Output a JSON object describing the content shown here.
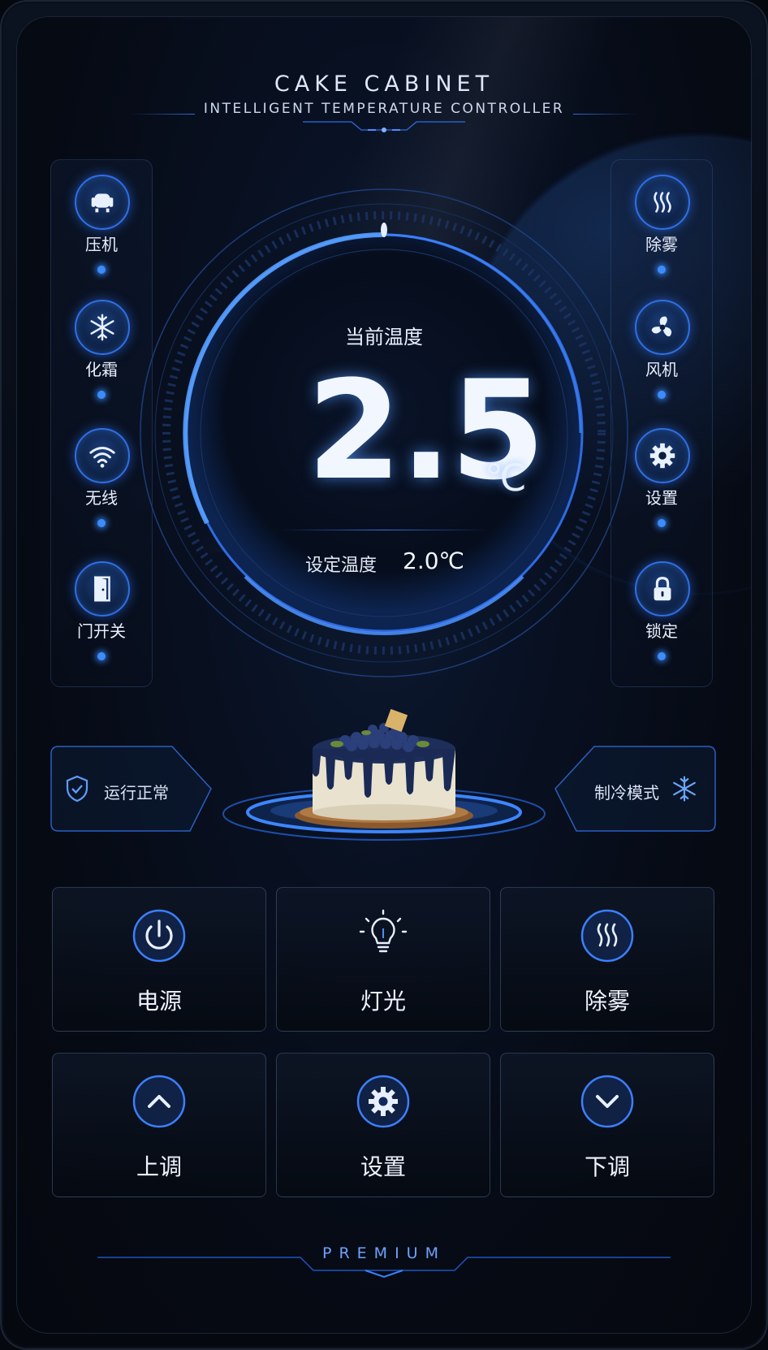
{
  "header": {
    "title": "CAKE CABINET",
    "subtitle": "INTELLIGENT TEMPERATURE CONTROLLER"
  },
  "left_panel": {
    "items": [
      {
        "label": "压机",
        "icon": "compressor-icon"
      },
      {
        "label": "化霜",
        "icon": "snowflake-icon"
      },
      {
        "label": "无线",
        "icon": "wifi-icon"
      },
      {
        "label": "门开关",
        "icon": "door-icon"
      }
    ]
  },
  "right_panel": {
    "items": [
      {
        "label": "除雾",
        "icon": "heat-waves-icon"
      },
      {
        "label": "风机",
        "icon": "fan-icon"
      },
      {
        "label": "设置",
        "icon": "gear-icon"
      },
      {
        "label": "锁定",
        "icon": "lock-icon"
      }
    ]
  },
  "dial": {
    "current_label": "当前温度",
    "current_value": "2.5",
    "unit": "℃",
    "set_label": "设定温度",
    "set_value": "2.0℃"
  },
  "status": {
    "left_text": "运行正常",
    "left_icon": "shield-check-icon",
    "right_text": "制冷模式",
    "right_icon": "snowflake-icon"
  },
  "buttons": [
    {
      "label": "电源",
      "icon": "power-icon"
    },
    {
      "label": "灯光",
      "icon": "lightbulb-icon"
    },
    {
      "label": "除雾",
      "icon": "heat-waves-icon"
    },
    {
      "label": "上调",
      "icon": "chevron-up-icon"
    },
    {
      "label": "设置",
      "icon": "gear-icon"
    },
    {
      "label": "下调",
      "icon": "chevron-down-icon"
    }
  ],
  "footer": {
    "brand": "PREMIUM"
  },
  "colors": {
    "accent": "#2f6fe8",
    "glow": "#3b8cff",
    "background": "#05080f"
  }
}
